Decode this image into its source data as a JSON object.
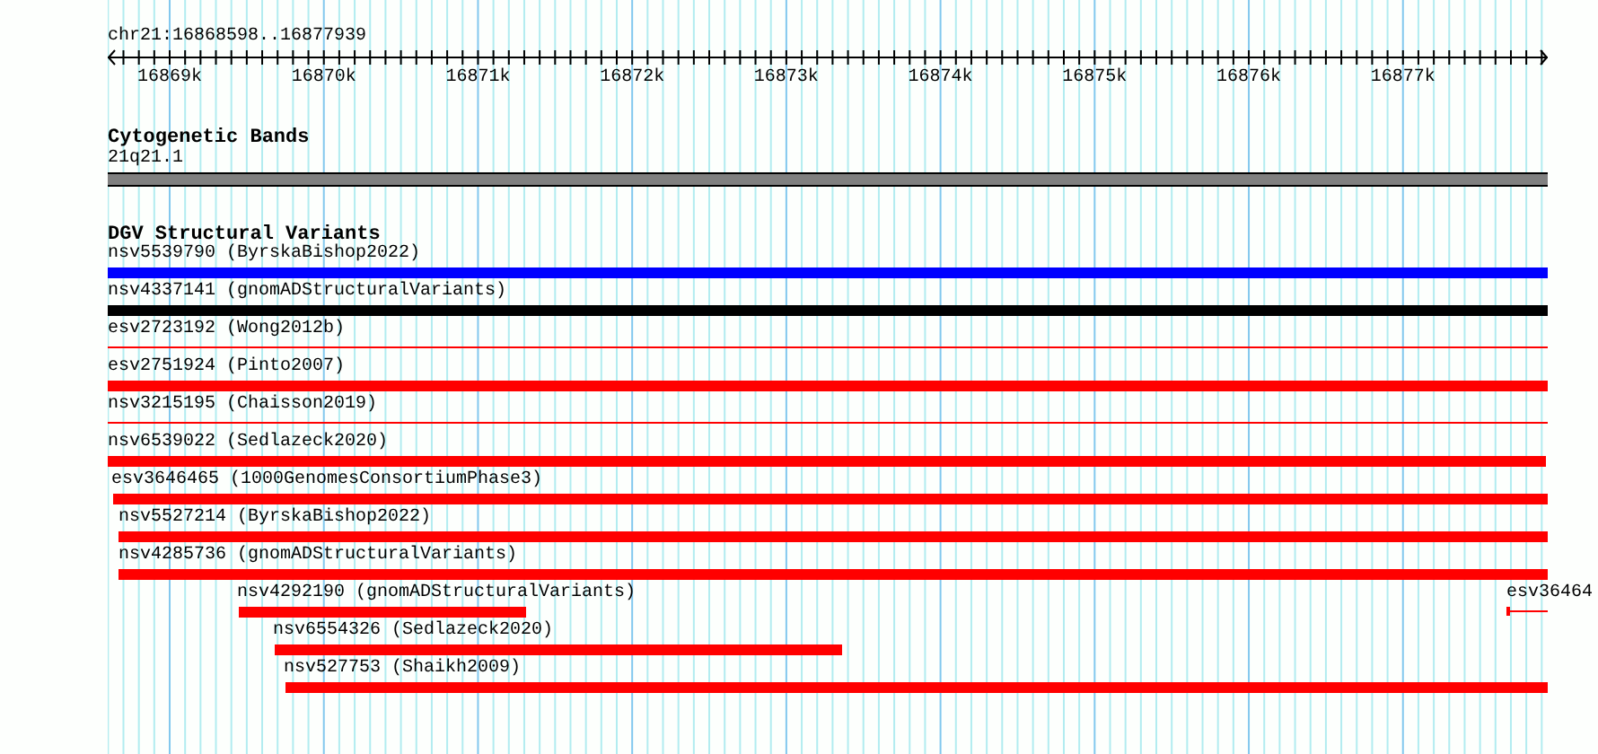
{
  "ruler": {
    "title": "chr21:16868598..16877939",
    "ticks": [
      "16869k",
      "16870k",
      "16871k",
      "16872k",
      "16873k",
      "16874k",
      "16875k",
      "16876k",
      "16877k"
    ]
  },
  "cytogenetic_bands": {
    "title": "Cytogenetic Bands",
    "band": "21q21.1"
  },
  "dgv": {
    "title": "DGV Structural Variants",
    "rows": [
      {
        "features": [
          {
            "label": "nsv5539790 (ByrskaBishop2022)",
            "kind": "thick",
            "color": "#0000ff"
          }
        ]
      },
      {
        "features": [
          {
            "label": "nsv4337141 (gnomADStructuralVariants)",
            "kind": "thick",
            "color": "#000000"
          }
        ]
      },
      {
        "features": [
          {
            "label": "esv2723192 (Wong2012b)",
            "kind": "thin",
            "color": "#ff0000"
          }
        ]
      },
      {
        "features": [
          {
            "label": "esv2751924 (Pinto2007)",
            "kind": "thick",
            "color": "#ff0000"
          }
        ]
      },
      {
        "features": [
          {
            "label": "nsv3215195 (Chaisson2019)",
            "kind": "thin",
            "color": "#ff0000"
          }
        ]
      },
      {
        "features": [
          {
            "label": "nsv6539022 (Sedlazeck2020)",
            "kind": "thick",
            "color": "#ff0000"
          }
        ]
      },
      {
        "features": [
          {
            "label": "esv3646465 (1000GenomesConsortiumPhase3)",
            "kind": "thick",
            "color": "#ff0000"
          }
        ]
      },
      {
        "features": [
          {
            "label": "nsv5527214 (ByrskaBishop2022)",
            "kind": "thick",
            "color": "#ff0000"
          }
        ]
      },
      {
        "features": [
          {
            "label": "nsv4285736 (gnomADStructuralVariants)",
            "kind": "thick",
            "color": "#ff0000"
          }
        ]
      },
      {
        "features": [
          {
            "label": "nsv4292190 (gnomADStructuralVariants)",
            "kind": "thick",
            "color": "#ff0000"
          },
          {
            "label": "esv36464",
            "kind": "thin-start",
            "color": "#ff0000"
          }
        ]
      },
      {
        "features": [
          {
            "label": "nsv6554326 (Sedlazeck2020)",
            "kind": "thick",
            "color": "#ff0000"
          }
        ]
      },
      {
        "features": [
          {
            "label": "nsv527753 (Shaikh2009)",
            "kind": "thick",
            "color": "#ff0000"
          }
        ]
      }
    ]
  }
}
